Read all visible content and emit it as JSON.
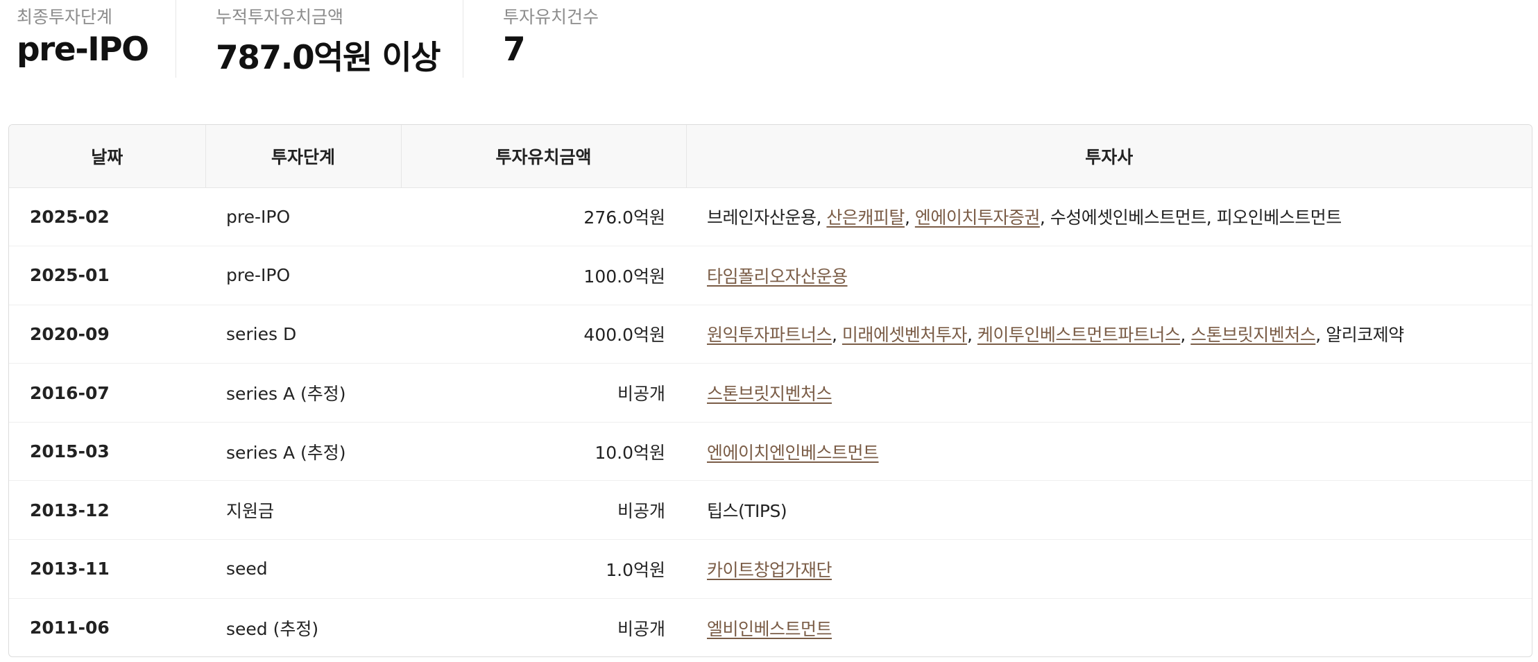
{
  "summary": {
    "final_stage_label": "최종투자단계",
    "final_stage_value": "pre-IPO",
    "cumulative_label": "누적투자유치금액",
    "cumulative_value": "787.0억원 이상",
    "count_label": "투자유치건수",
    "count_value": "7"
  },
  "table": {
    "headers": [
      "날짜",
      "투자단계",
      "투자유치금액",
      "투자사"
    ],
    "rows": [
      {
        "date": "2025-02",
        "stage": "pre-IPO",
        "amount": "276.0억원",
        "investors": [
          {
            "name": "브레인자산운용",
            "link": false
          },
          {
            "name": "산은캐피탈",
            "link": true
          },
          {
            "name": "엔에이치투자증권",
            "link": true
          },
          {
            "name": "수성에셋인베스트먼트",
            "link": false
          },
          {
            "name": "피오인베스트먼트",
            "link": false
          }
        ]
      },
      {
        "date": "2025-01",
        "stage": "pre-IPO",
        "amount": "100.0억원",
        "investors": [
          {
            "name": "타임폴리오자산운용",
            "link": true
          }
        ]
      },
      {
        "date": "2020-09",
        "stage": "series D",
        "amount": "400.0억원",
        "investors": [
          {
            "name": "원익투자파트너스",
            "link": true
          },
          {
            "name": "미래에셋벤처투자",
            "link": true
          },
          {
            "name": "케이투인베스트먼트파트너스",
            "link": true
          },
          {
            "name": "스톤브릿지벤처스",
            "link": true
          },
          {
            "name": "알리코제약",
            "link": false
          }
        ]
      },
      {
        "date": "2016-07",
        "stage": "series A (추정)",
        "amount": "비공개",
        "investors": [
          {
            "name": "스톤브릿지벤처스",
            "link": true
          }
        ]
      },
      {
        "date": "2015-03",
        "stage": "series A (추정)",
        "amount": "10.0억원",
        "investors": [
          {
            "name": "엔에이치엔인베스트먼트",
            "link": true
          }
        ]
      },
      {
        "date": "2013-12",
        "stage": "지원금",
        "amount": "비공개",
        "investors": [
          {
            "name": "팁스(TIPS)",
            "link": false
          }
        ]
      },
      {
        "date": "2013-11",
        "stage": "seed",
        "amount": "1.0억원",
        "investors": [
          {
            "name": "카이트창업가재단",
            "link": true
          }
        ]
      },
      {
        "date": "2011-06",
        "stage": "seed (추정)",
        "amount": "비공개",
        "investors": [
          {
            "name": "엘비인베스트먼트",
            "link": true
          }
        ]
      }
    ]
  },
  "colors": {
    "link": "#7a5c46",
    "header_bg": "#f8f8f8",
    "label_gray": "#8c8c8c"
  }
}
